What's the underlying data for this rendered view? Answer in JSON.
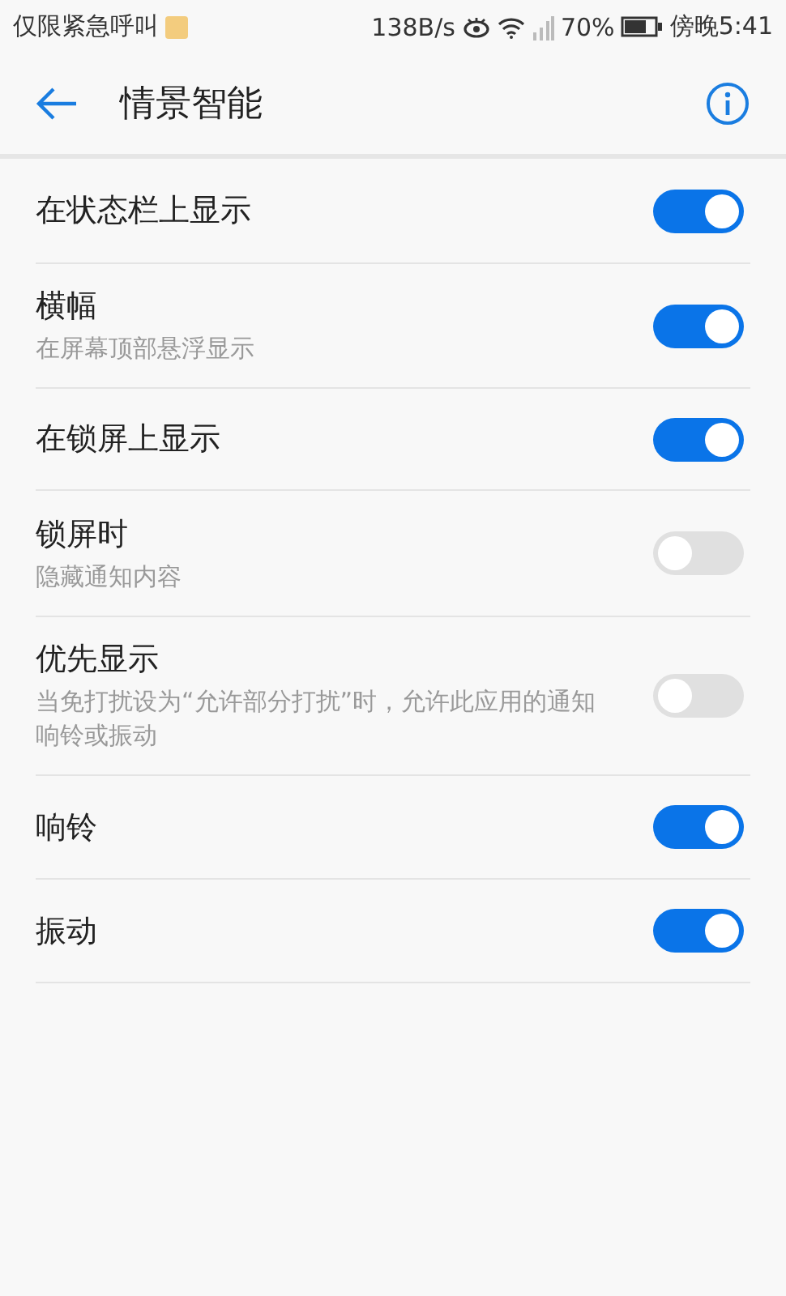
{
  "status_bar": {
    "carrier": "仅限紧急呼叫",
    "speed": "138B/s",
    "battery": "70%",
    "time": "傍晚5:41"
  },
  "header": {
    "title": "情景智能"
  },
  "settings": [
    {
      "label": "在状态栏上显示",
      "on": true
    },
    {
      "label": "横幅",
      "description": "在屏幕顶部悬浮显示",
      "on": true
    },
    {
      "label": "在锁屏上显示",
      "on": true
    },
    {
      "label": "锁屏时",
      "description": "隐藏通知内容",
      "on": false
    },
    {
      "label": "优先显示",
      "description": "当免打扰设为“允许部分打扰”时，允许此应用的通知响铃或振动",
      "on": false
    },
    {
      "label": "响铃",
      "on": true
    },
    {
      "label": "振动",
      "on": true
    }
  ]
}
